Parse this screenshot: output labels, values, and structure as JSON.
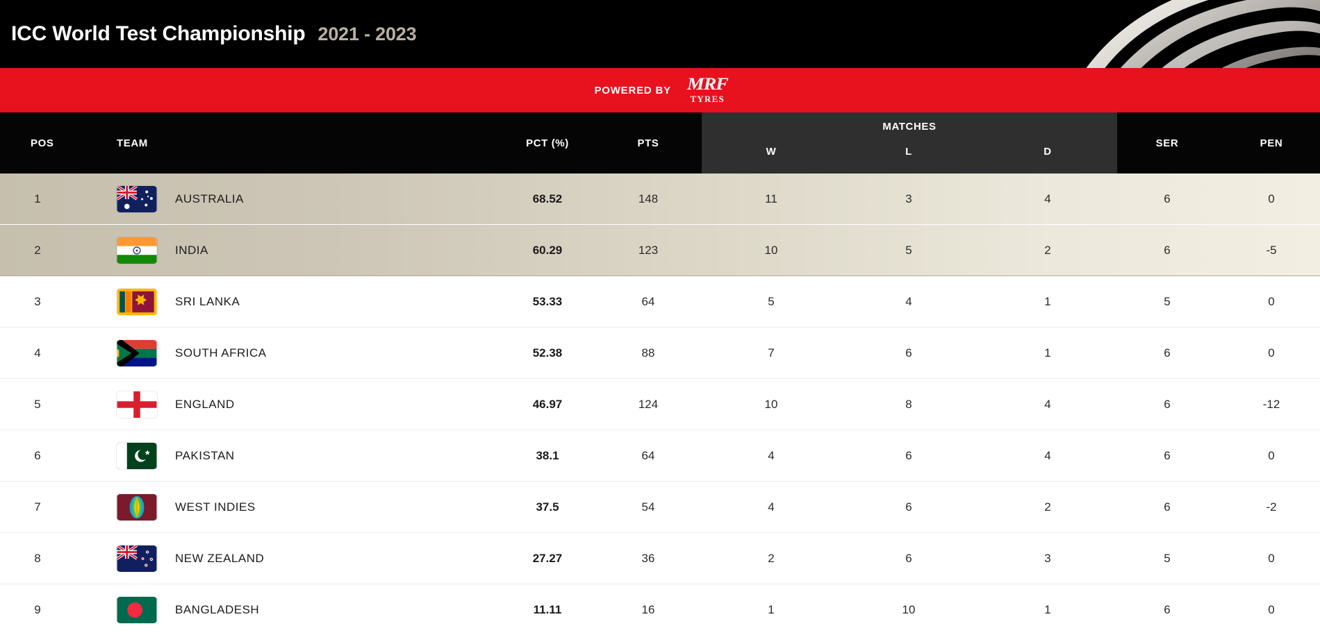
{
  "header": {
    "title": "ICC World Test Championship",
    "years": "2021 - 2023",
    "swoosh_icon": "swoosh-graphic"
  },
  "banner": {
    "powered_by": "POWERED BY",
    "sponsor_top": "MRF",
    "sponsor_bottom": "TYRES",
    "background_color": "#e8111e"
  },
  "table": {
    "columns": {
      "pos": "POS",
      "team": "TEAM",
      "pct": "PCT (%)",
      "pts": "PTS",
      "matches": "MATCHES",
      "w": "W",
      "l": "L",
      "d": "D",
      "ser": "SER",
      "pen": "PEN"
    },
    "rows": [
      {
        "pos": "1",
        "team": "AUSTRALIA",
        "flag": "flag-australia",
        "pct": "68.52",
        "pts": "148",
        "w": "11",
        "l": "3",
        "d": "4",
        "ser": "6",
        "pen": "0",
        "highlight": true
      },
      {
        "pos": "2",
        "team": "INDIA",
        "flag": "flag-india",
        "pct": "60.29",
        "pts": "123",
        "w": "10",
        "l": "5",
        "d": "2",
        "ser": "6",
        "pen": "-5",
        "highlight": true
      },
      {
        "pos": "3",
        "team": "SRI LANKA",
        "flag": "flag-sri-lanka",
        "pct": "53.33",
        "pts": "64",
        "w": "5",
        "l": "4",
        "d": "1",
        "ser": "5",
        "pen": "0",
        "highlight": false
      },
      {
        "pos": "4",
        "team": "SOUTH AFRICA",
        "flag": "flag-south-africa",
        "pct": "52.38",
        "pts": "88",
        "w": "7",
        "l": "6",
        "d": "1",
        "ser": "6",
        "pen": "0",
        "highlight": false
      },
      {
        "pos": "5",
        "team": "ENGLAND",
        "flag": "flag-england",
        "pct": "46.97",
        "pts": "124",
        "w": "10",
        "l": "8",
        "d": "4",
        "ser": "6",
        "pen": "-12",
        "highlight": false
      },
      {
        "pos": "6",
        "team": "PAKISTAN",
        "flag": "flag-pakistan",
        "pct": "38.1",
        "pts": "64",
        "w": "4",
        "l": "6",
        "d": "4",
        "ser": "6",
        "pen": "0",
        "highlight": false
      },
      {
        "pos": "7",
        "team": "WEST INDIES",
        "flag": "flag-west-indies",
        "pct": "37.5",
        "pts": "54",
        "w": "4",
        "l": "6",
        "d": "2",
        "ser": "6",
        "pen": "-2",
        "highlight": false
      },
      {
        "pos": "8",
        "team": "NEW ZEALAND",
        "flag": "flag-new-zealand",
        "pct": "27.27",
        "pts": "36",
        "w": "2",
        "l": "6",
        "d": "3",
        "ser": "5",
        "pen": "0",
        "highlight": false
      },
      {
        "pos": "9",
        "team": "BANGLADESH",
        "flag": "flag-bangladesh",
        "pct": "11.11",
        "pts": "16",
        "w": "1",
        "l": "10",
        "d": "1",
        "ser": "6",
        "pen": "0",
        "highlight": false
      }
    ]
  }
}
